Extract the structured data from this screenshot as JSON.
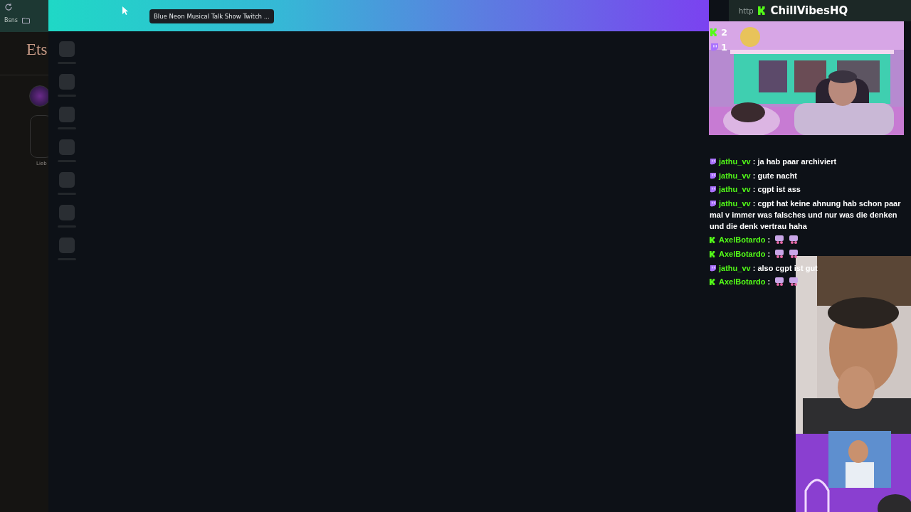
{
  "browser": {
    "bookmark": "Bsns",
    "site_title": "Ets",
    "caption": "Lieb"
  },
  "editor": {
    "tooltip": "Blue Neon Musical Talk Show Twitch ...",
    "skeleton": [
      {
        "kind": "tile"
      },
      {
        "kind": "tile"
      },
      {
        "kind": "tile"
      },
      {
        "kind": "tile"
      },
      {
        "kind": "tile"
      },
      {
        "kind": "tile"
      },
      {
        "kind": "tile"
      }
    ]
  },
  "stream": {
    "url_prefix": "http",
    "channel": "ChillVibesHQ",
    "viewers": [
      {
        "kind": "kick",
        "count": "2"
      },
      {
        "kind": "twitch",
        "count": "1"
      }
    ],
    "chat": [
      {
        "kind": "twitch",
        "user": "jathu_vv",
        "text": ": ja hab paar archiviert"
      },
      {
        "kind": "twitch",
        "user": "jathu_vv",
        "text": ": gute nacht"
      },
      {
        "kind": "twitch",
        "user": "jathu_vv",
        "text": ": cgpt ist ass"
      },
      {
        "kind": "twitch",
        "user": "jathu_vv",
        "text": ": cgpt hat keine ahnung hab schon paar mal v immer was falsches und nur was die denken und die denk vertrau haha"
      },
      {
        "kind": "kick",
        "user": "AxelBotardo",
        "text": ":"
      },
      {
        "kind": "kick",
        "user": "AxelBotardo",
        "text": ":"
      },
      {
        "kind": "twitch",
        "user": "jathu_vv",
        "text": ": also cgpt ist gut"
      },
      {
        "kind": "kick",
        "user": "AxelBotardo",
        "text": ":"
      }
    ]
  }
}
